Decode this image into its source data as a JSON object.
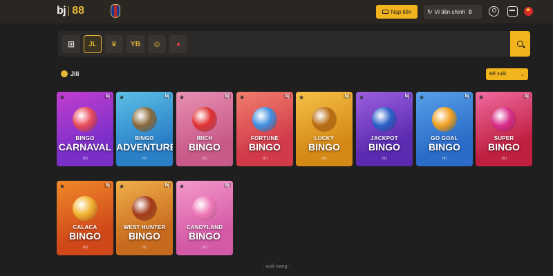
{
  "header": {
    "logo_left": "bj",
    "logo_right": "88",
    "deposit_label": "Nạp tiền",
    "wallet_label": "Ví tiền chính",
    "wallet_balance": "0"
  },
  "providers": [
    {
      "label": "⊞"
    },
    {
      "label": "JL"
    },
    {
      "label": "♛"
    },
    {
      "label": "YB"
    },
    {
      "label": "◎"
    },
    {
      "label": "●"
    }
  ],
  "section": {
    "title": "Jili",
    "sort_label": "Đề xuất"
  },
  "games": [
    {
      "line1": "BINGO",
      "line2": "CARNAVAL",
      "provider": "JILI",
      "bg": "#7a2fc9",
      "bg2": "#c23ed0",
      "art": "#e94c5a"
    },
    {
      "line1": "BINGO",
      "line2": "ADVENTURE",
      "provider": "JILI",
      "bg": "#2a7fc7",
      "bg2": "#5cc0e6",
      "art": "#8a6a3b"
    },
    {
      "line1": "IRICH",
      "line2": "BINGO",
      "provider": "JILI",
      "bg": "#c85a8a",
      "bg2": "#e890b2",
      "art": "#e03030"
    },
    {
      "line1": "FORTUNE",
      "line2": "BINGO",
      "provider": "JILI",
      "bg": "#d23a4a",
      "bg2": "#f07e6c",
      "art": "#3f8fe0"
    },
    {
      "line1": "LUCKY",
      "line2": "BINGO",
      "provider": "JILI",
      "bg": "#d48916",
      "bg2": "#f6c048",
      "art": "#b86a10"
    },
    {
      "line1": "JACKPOT",
      "line2": "BINGO",
      "provider": "JILI",
      "bg": "#5a2ab0",
      "bg2": "#9b5fe0",
      "art": "#2a60c8"
    },
    {
      "line1": "GO GOAL",
      "line2": "BINGO",
      "provider": "JILI",
      "bg": "#2a6cc8",
      "bg2": "#58a0ea",
      "art": "#f0a020"
    },
    {
      "line1": "SUPER",
      "line2": "BINGO",
      "provider": "JILI",
      "bg": "#c02040",
      "bg2": "#f06aa0",
      "art": "#d82c8a"
    },
    {
      "line1": "CALACA",
      "line2": "BINGO",
      "provider": "JILI",
      "bg": "#d0481a",
      "bg2": "#f08a2a",
      "art": "#f2b431"
    },
    {
      "line1": "WEST HUNTER",
      "line2": "BINGO",
      "provider": "JILI",
      "bg": "#c86a1e",
      "bg2": "#efb04a",
      "art": "#a33a1a"
    },
    {
      "line1": "CANDYLAND",
      "line2": "BINGO",
      "provider": "JILI",
      "bg": "#d45aa8",
      "bg2": "#f49ac9",
      "art": "#f07ab8"
    }
  ],
  "footer": {
    "end_text": "- cuối trang -"
  }
}
